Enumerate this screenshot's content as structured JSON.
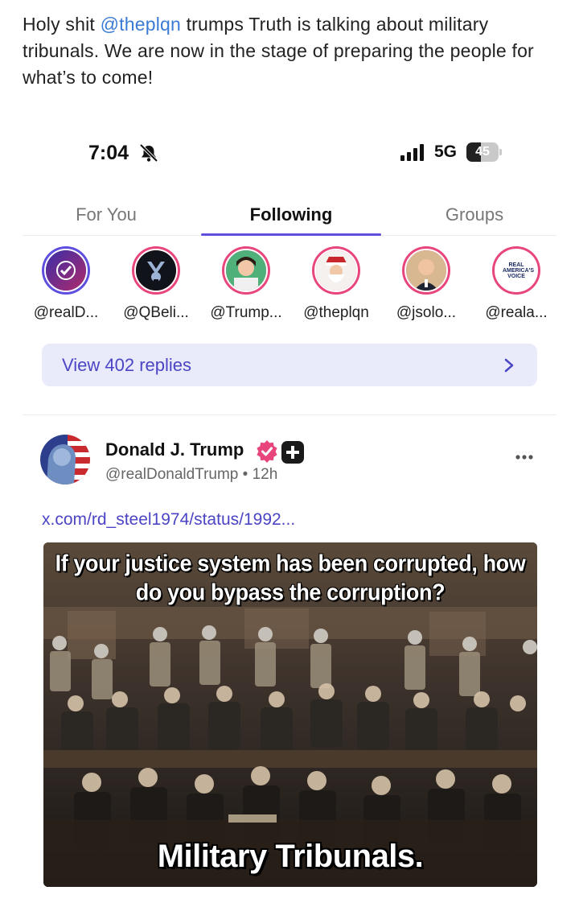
{
  "caption": {
    "before": "Holy shit ",
    "mention": "@theplqn",
    "after": " trumps Truth is talking about military tribunals. We are now in the stage of preparing the people for what’s to come!"
  },
  "status_bar": {
    "time": "7:04",
    "network": "5G",
    "battery_level": 45,
    "battery_text": "45",
    "icons": [
      "bell-slash-icon",
      "signal-bars-icon",
      "battery-icon"
    ]
  },
  "tabs": [
    {
      "label": "For You",
      "active": false
    },
    {
      "label": "Following",
      "active": true
    },
    {
      "label": "Groups",
      "active": false
    }
  ],
  "avatars": [
    {
      "handle": "@realD...",
      "ring": "#5d4ee0"
    },
    {
      "handle": "@QBeli...",
      "ring": "#e8457c"
    },
    {
      "handle": "@Trump...",
      "ring": "#e8457c"
    },
    {
      "handle": "@theplqn",
      "ring": "#e8457c"
    },
    {
      "handle": "@jsolo...",
      "ring": "#e8457c"
    },
    {
      "handle": "@reala...",
      "ring": "#e8457c",
      "logo_text": "REAL AMERICA'S VOICE"
    }
  ],
  "replies": {
    "label": "View 402 replies",
    "icon": "chevron-right-icon"
  },
  "post": {
    "author": "Donald J. Trump",
    "handle_time": "@realDonaldTrump • 12h",
    "link": "x.com/rd_steel1974/status/1992...",
    "image_headline": "If your justice system has been corrupted, how do you bypass the corruption?",
    "image_caption": "Military Tribunals.",
    "icons": [
      "verified-badge-icon",
      "plus-badge-icon",
      "more-dots-icon"
    ]
  },
  "colors": {
    "accent": "#5d4ee0",
    "link": "#4b44c4",
    "mention": "#3a7bd5",
    "verified": "#e8457c",
    "replies_bg": "#e9ebfb"
  }
}
